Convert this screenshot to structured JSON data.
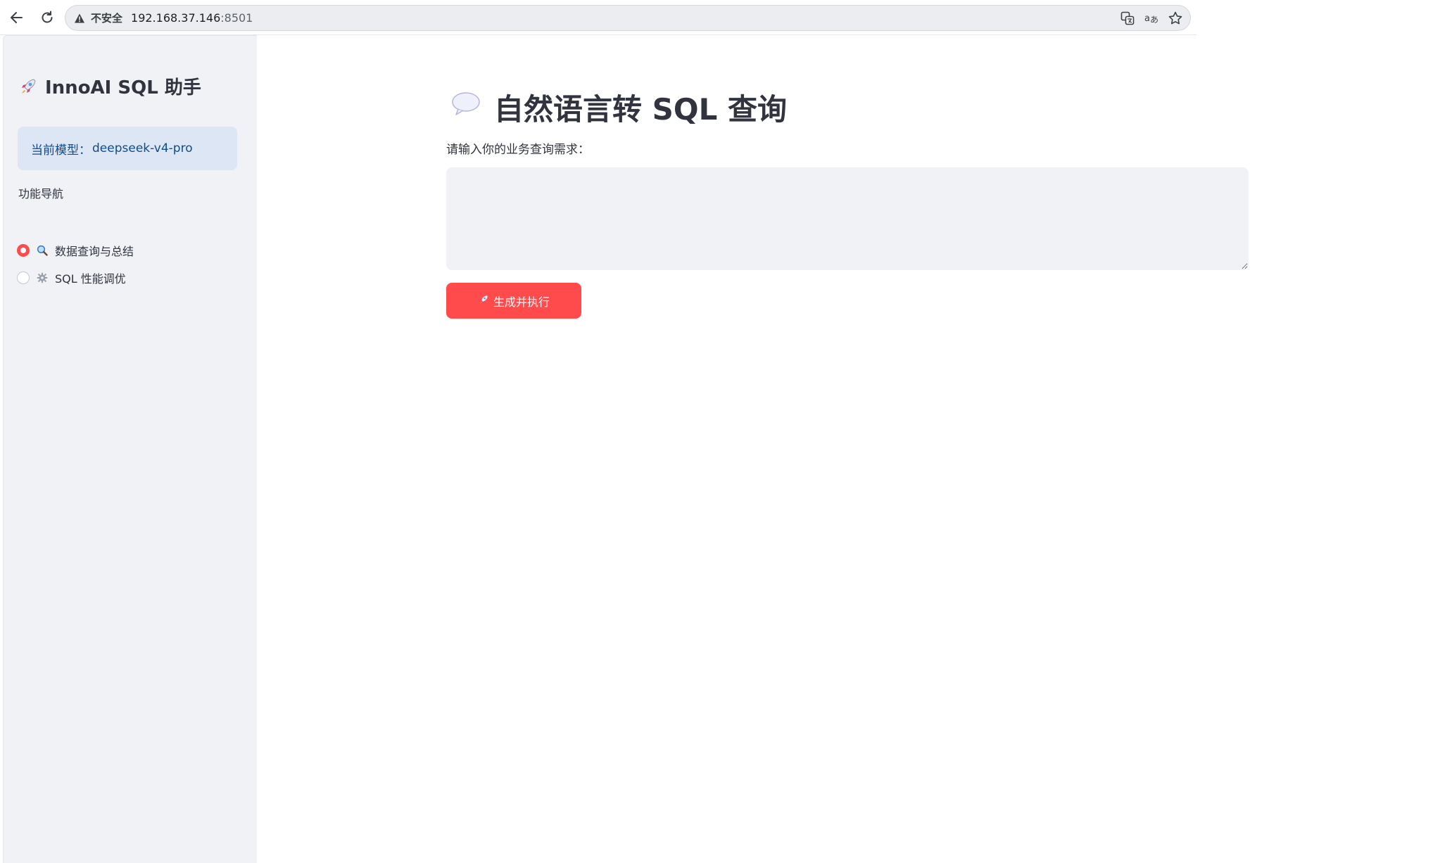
{
  "browser": {
    "security_label": "不安全",
    "url_host": "192.168.37.146",
    "url_port": ":8501",
    "icons": [
      "back-icon",
      "reload-icon",
      "warning-icon",
      "translate-icon",
      "read-aloud-icon",
      "bookmark-star-icon"
    ]
  },
  "sidebar": {
    "title": "InnoAI SQL 助手",
    "model_label": "当前模型：",
    "model_name": "deepseek-v4-pro",
    "nav_heading": "功能导航",
    "nav_options": [
      {
        "label": "数据查询与总结",
        "icon": "magnifier-icon",
        "selected": true
      },
      {
        "label": "SQL 性能调优",
        "icon": "gear-icon",
        "selected": false
      }
    ]
  },
  "main": {
    "title": "自然语言转 SQL 查询",
    "title_icon": "speech-bubble-icon",
    "input_label": "请输入你的业务查询需求：",
    "input_value": "",
    "run_button_label": "生成并执行",
    "run_button_icon": "rocket-icon"
  },
  "colors": {
    "accent": "#ff4b4b",
    "sidebar_bg": "#f0f2f6",
    "model_box_bg": "#dce6f5",
    "model_text": "#0e4d8f",
    "loading_strip": "#2ad4d4"
  }
}
